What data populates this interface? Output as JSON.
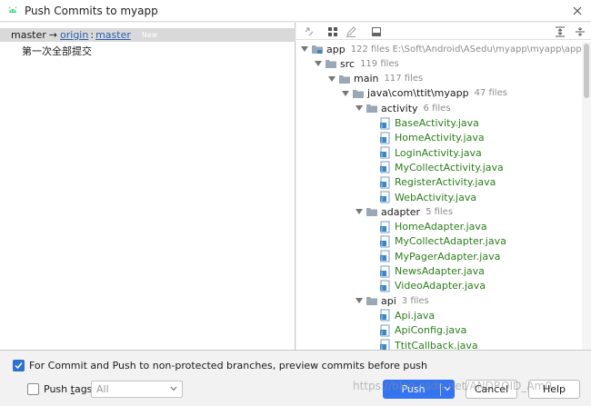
{
  "window": {
    "title": "Push Commits to myapp"
  },
  "left": {
    "branch": {
      "local": "master",
      "arrow": "→",
      "remote": "origin",
      "separator": ":",
      "remote_branch": "master",
      "badge": "New"
    },
    "commits": [
      {
        "message": "第一次全部提交"
      }
    ]
  },
  "toolbar": {
    "icons": [
      "expand-arrows-icon",
      "group-by-icon",
      "edit-source-icon",
      "preview-diff-icon",
      "expand-all-icon",
      "collapse-all-icon"
    ]
  },
  "tree": [
    {
      "name": "app",
      "meta": "122 files  E:\\Soft\\Android\\ASedu\\myapp\\myapp\\app",
      "type": "module",
      "depth": 0
    },
    {
      "name": "src",
      "meta": "119 files",
      "type": "folder",
      "depth": 1
    },
    {
      "name": "main",
      "meta": "117 files",
      "type": "folder",
      "depth": 2
    },
    {
      "name": "java\\com\\ttit\\myapp",
      "meta": "47 files",
      "type": "folder",
      "depth": 3
    },
    {
      "name": "activity",
      "meta": "6 files",
      "type": "folder",
      "depth": 4
    },
    {
      "name": "BaseActivity.java",
      "meta": "",
      "type": "file",
      "depth": 5
    },
    {
      "name": "HomeActivity.java",
      "meta": "",
      "type": "file",
      "depth": 5
    },
    {
      "name": "LoginActivity.java",
      "meta": "",
      "type": "file",
      "depth": 5
    },
    {
      "name": "MyCollectActivity.java",
      "meta": "",
      "type": "file",
      "depth": 5
    },
    {
      "name": "RegisterActivity.java",
      "meta": "",
      "type": "file",
      "depth": 5
    },
    {
      "name": "WebActivity.java",
      "meta": "",
      "type": "file",
      "depth": 5
    },
    {
      "name": "adapter",
      "meta": "5 files",
      "type": "folder",
      "depth": 4
    },
    {
      "name": "HomeAdapter.java",
      "meta": "",
      "type": "file",
      "depth": 5
    },
    {
      "name": "MyCollectAdapter.java",
      "meta": "",
      "type": "file",
      "depth": 5
    },
    {
      "name": "MyPagerAdapter.java",
      "meta": "",
      "type": "file",
      "depth": 5
    },
    {
      "name": "NewsAdapter.java",
      "meta": "",
      "type": "file",
      "depth": 5
    },
    {
      "name": "VideoAdapter.java",
      "meta": "",
      "type": "file",
      "depth": 5
    },
    {
      "name": "api",
      "meta": "3 files",
      "type": "folder",
      "depth": 4
    },
    {
      "name": "Api.java",
      "meta": "",
      "type": "file",
      "depth": 5
    },
    {
      "name": "ApiConfig.java",
      "meta": "",
      "type": "file",
      "depth": 5
    },
    {
      "name": "TtitCallback.java",
      "meta": "",
      "type": "file",
      "depth": 5
    }
  ],
  "bottom": {
    "preview_checkbox": {
      "label": "For Commit and Push to non-protected branches, preview commits before push",
      "checked": true
    },
    "tags_checkbox": {
      "label_prefix": "Push ",
      "label_underlined": "t",
      "label_suffix": "ags:",
      "checked": false
    },
    "tags_select": {
      "value": "All"
    },
    "buttons": {
      "push": "Push",
      "cancel": "Cancel",
      "help": "Help"
    }
  },
  "watermark": "https://blog.csdn.net/ANDROID_Am0"
}
